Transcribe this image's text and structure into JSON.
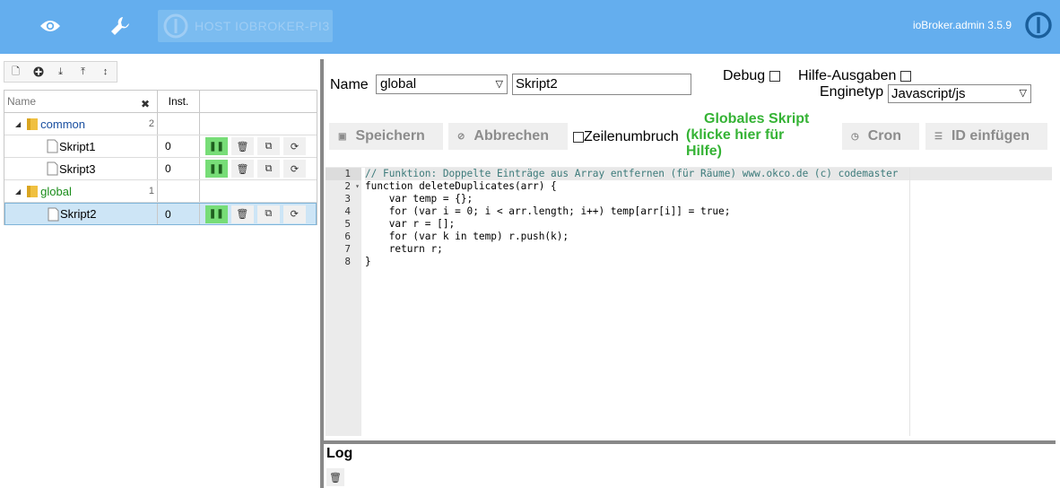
{
  "topbar": {
    "icons": [
      "eye-icon",
      "wrench-icon"
    ],
    "host_label": "HOST IOBROKER-PI3",
    "version": "ioBroker.admin 3.5.9",
    "bg_color": "#64aeee"
  },
  "left": {
    "toolbar_icons": [
      "new-script-icon",
      "add-folder-icon",
      "import-icon",
      "export-icon",
      "expand-collapse-icon"
    ],
    "columns": {
      "name_placeholder": "Name",
      "inst": "Inst."
    },
    "tree": {
      "common": {
        "label": "common",
        "count": "2"
      },
      "skript1": {
        "label": "Skript1",
        "inst": "0"
      },
      "skript3": {
        "label": "Skript3",
        "inst": "0"
      },
      "global": {
        "label": "global",
        "count": "1"
      },
      "skript2": {
        "label": "Skript2",
        "inst": "0"
      }
    }
  },
  "right": {
    "name_label": "Name",
    "folder_value": "global",
    "name_value": "Skript2",
    "debug_label": "Debug",
    "hilfe_label": "Hilfe-Ausgaben",
    "enginetyp_label": "Enginetyp",
    "enginetyp_value": "Javascript/js",
    "save_label": "Speichern",
    "cancel_label": "Abbrechen",
    "wrap_label": "Zeilenumbruch",
    "global_hint_l1": "Globales Skript",
    "global_hint_l2": "(klicke hier für",
    "global_hint_l3": "Hilfe)",
    "cron_label": "Cron",
    "insert_id_label": "ID einfügen"
  },
  "editor": {
    "line_numbers": [
      "1",
      "2",
      "3",
      "4",
      "5",
      "6",
      "7",
      "8"
    ],
    "lines": [
      "// Funktion: Doppelte Einträge aus Array entfernen (für Räume) www.okco.de (c) codemaster",
      "function deleteDuplicates(arr) {",
      "    var temp = {};",
      "    for (var i = 0; i < arr.length; i++) temp[arr[i]] = true;",
      "    var r = [];",
      "    for (var k in temp) r.push(k);",
      "    return r;",
      "}"
    ]
  },
  "log": {
    "title": "Log"
  }
}
